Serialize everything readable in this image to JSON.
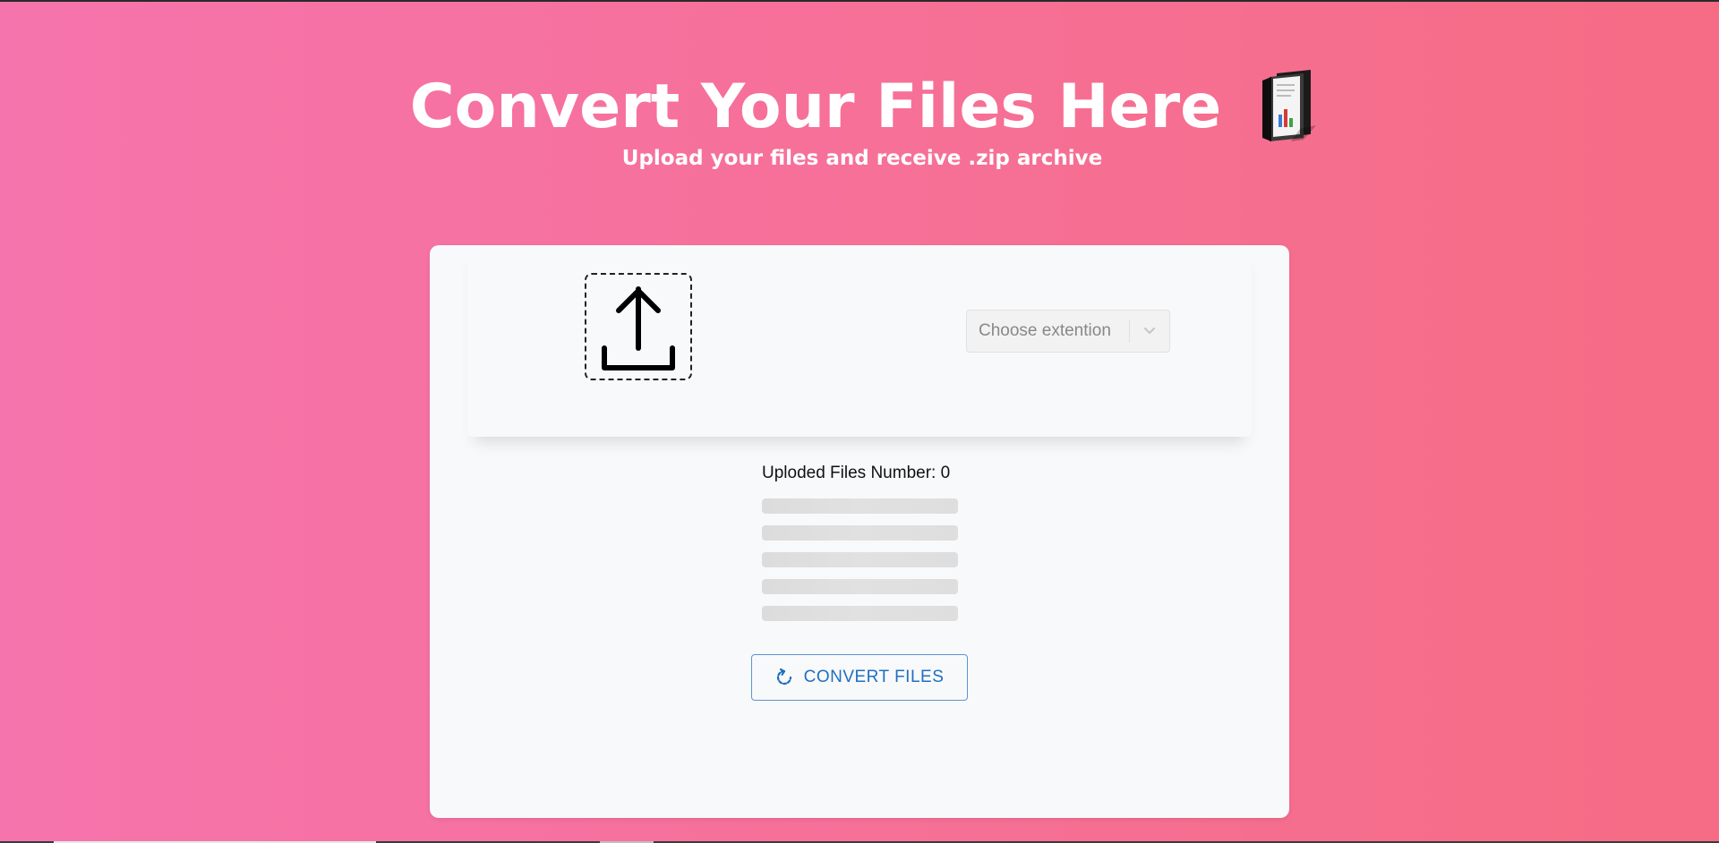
{
  "header": {
    "title": "Convert Your Files Here",
    "subtitle": "Upload your files and receive .zip archive"
  },
  "upload": {
    "dropzone_icon": "upload-icon",
    "extension_select": {
      "placeholder": "Choose extention",
      "arrow_icon": "chevron-down-icon"
    }
  },
  "files": {
    "label": "Uploded Files Number: 0",
    "placeholder_rows": 5
  },
  "actions": {
    "convert_label": "CONVERT FILES",
    "convert_icon": "refresh-icon"
  },
  "colors": {
    "background_start": "#f674ad",
    "background_end": "#f66c85",
    "card": "#f8f9fa",
    "button_accent": "#1f6fc1"
  }
}
